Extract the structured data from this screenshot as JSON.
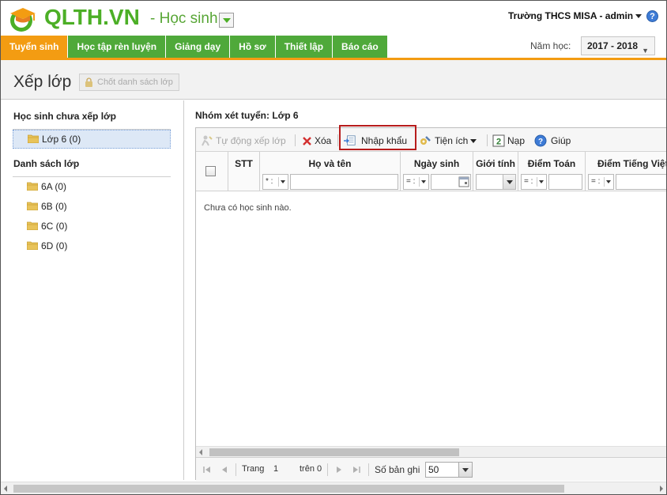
{
  "header": {
    "logo_text": "QLTH.VN",
    "module_name": "- Học sinh",
    "user": "Trường THCS MISA - admin",
    "help_symbol": "?"
  },
  "nav": {
    "tabs": [
      {
        "label": "Tuyển sinh",
        "active": true
      },
      {
        "label": "Học tập rèn luyện",
        "active": false
      },
      {
        "label": "Giảng dạy",
        "active": false
      },
      {
        "label": "Hồ sơ",
        "active": false
      },
      {
        "label": "Thiết lập",
        "active": false
      },
      {
        "label": "Báo cáo",
        "active": false
      }
    ],
    "year_label": "Năm học:",
    "year_value": "2017 - 2018"
  },
  "page": {
    "title": "Xếp lớp",
    "lock_button": "Chốt danh sách lớp"
  },
  "left": {
    "unassigned_heading": "Học sinh chưa xếp lớp",
    "unassigned_items": [
      {
        "label": "Lớp 6 (0)",
        "selected": true
      }
    ],
    "classes_heading": "Danh sách lớp",
    "classes": [
      {
        "label": "6A (0)"
      },
      {
        "label": "6B (0)"
      },
      {
        "label": "6C (0)"
      },
      {
        "label": "6D (0)"
      }
    ]
  },
  "main": {
    "group_title": "Nhóm xét tuyển: Lớp 6",
    "toolbar": {
      "auto_assign": "Tự động xếp lớp",
      "delete": "Xóa",
      "import": "Nhập khẩu",
      "utilities": "Tiện ích",
      "reload": "Nạp",
      "help": "Giúp"
    },
    "columns": {
      "stt": "STT",
      "name": "Họ và tên",
      "dob": "Ngày sinh",
      "gender": "Giới tính",
      "math": "Điểm Toán",
      "vietnamese": "Điểm Tiếng Việt"
    },
    "filters": {
      "name_op": "* :",
      "dob_op": "= :",
      "math_op": "= :",
      "viet_op": "= :"
    },
    "empty_message": "Chưa có học sinh nào.",
    "pager": {
      "page_label": "Trang",
      "page_value": "1",
      "of_label": "trên 0",
      "records_label": "Số bản ghi",
      "page_size": "50"
    }
  },
  "colors": {
    "brand_green": "#4fa93a",
    "active_orange": "#f39c12",
    "highlight_red": "#b71c1c"
  },
  "icons": [
    "logo-mortarboard-icon",
    "dropdown-caret-icon",
    "help-icon",
    "lock-icon",
    "folder-icon",
    "auto-assign-icon",
    "delete-x-icon",
    "import-icon",
    "utilities-icon",
    "reload-icon",
    "calendar-icon",
    "first-page-icon",
    "prev-page-icon",
    "next-page-icon",
    "last-page-icon"
  ]
}
